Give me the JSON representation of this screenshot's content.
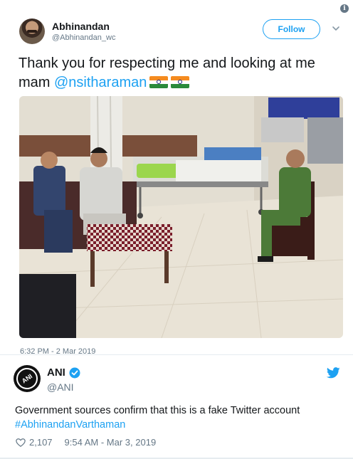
{
  "embedded_tweet": {
    "author_name": "Abhinandan",
    "author_handle": "@Abhinandan_wc",
    "follow_label": "Follow",
    "text_before": "Thank you for respecting me and looking at me mam ",
    "mention": "@nsitharaman",
    "flags": [
      "indian-flag-icon",
      "indian-flag-icon"
    ],
    "timestamp": "6:32 PM - 2 Mar 2019"
  },
  "ani_tweet": {
    "author_name": "ANI",
    "author_handle": "@ANI",
    "avatar_text": "ANI",
    "text": "Government sources confirm that this is a fake Twitter account",
    "hashtag": "#AbhinandanVarthaman",
    "like_count": "2,107",
    "timestamp": "9:54 AM - Mar 3, 2019"
  },
  "colors": {
    "brand_blue": "#1da1f2",
    "text_primary": "#14171a",
    "text_secondary": "#657786",
    "flag_saffron": "#f58b1f",
    "flag_green": "#2b8a3b"
  },
  "icons": {
    "info": "info-icon",
    "chevron": "chevron-down-icon",
    "verified": "verified-badge-icon",
    "twitter": "twitter-bird-icon",
    "like": "heart-icon"
  }
}
